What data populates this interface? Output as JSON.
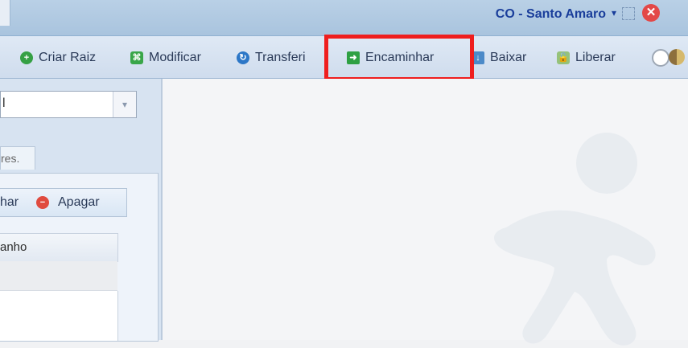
{
  "header": {
    "branch": "CO - Santo Amaro"
  },
  "toolbar": {
    "criar_raiz": "Criar Raiz",
    "modificar": "Modificar",
    "transferir": "Transferi",
    "encaminhar": "Encaminhar",
    "baixar": "Baixar",
    "liberar": "Liberar"
  },
  "left": {
    "select_value": "l",
    "tab_label": "res.",
    "inner_toolbar": {
      "partial_left": "har",
      "apagar": "Apagar"
    },
    "column_header": "anho"
  },
  "colors": {
    "highlight": "#ef1e1e",
    "header_text": "#1a3e9b"
  }
}
